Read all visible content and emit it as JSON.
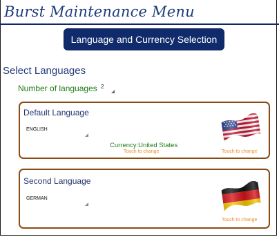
{
  "app": {
    "title": "Burst Maintenance Menu"
  },
  "section_button": "Language and Currency Selection",
  "section_heading": "Select Languages",
  "number_of_languages": {
    "label": "Number of languages",
    "value": "2"
  },
  "default_language": {
    "title": "Default Language",
    "selected": "ENGLISH",
    "currency": "Currency:United States",
    "currency_touch": "Touch to change",
    "flag_touch": "Touch to change",
    "flag_icon": "us-flag-icon"
  },
  "second_language": {
    "title": "Second Language",
    "selected": "GERMAN",
    "flag_touch": "Touch to change",
    "flag_icon": "german-flag-icon"
  },
  "colors": {
    "title_text": "#1d3c7a",
    "button_bg": "#0f2b6b",
    "green_text": "#1d7a16",
    "box_border": "#8a4a12",
    "touch_text": "#e98c2c"
  }
}
